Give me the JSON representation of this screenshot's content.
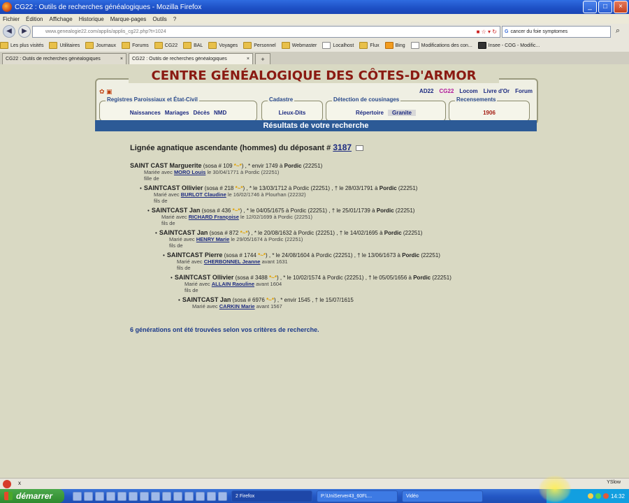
{
  "window": {
    "title": "CG22 : Outils de recherches généalogiques - Mozilla Firefox"
  },
  "menu": [
    "Fichier",
    "Édition",
    "Affichage",
    "Historique",
    "Marque-pages",
    "Outils",
    "?"
  ],
  "nav": {
    "url": "www.genealogie22.com/applis/applis_cg22.php?t=1024",
    "search_value": "cancer du foie symptomes"
  },
  "bookmarks": [
    "Les plus visités",
    "Utilitaires",
    "Journaux",
    "Forums",
    "CG22",
    "BAL",
    "Voyages",
    "Personnel",
    "Webmaster",
    "Localhost",
    "Flux",
    "Bing",
    "Modifications des con...",
    "Insee - COG - Modific..."
  ],
  "tabs": [
    {
      "label": "CG22 : Outils de recherches généalogiques"
    },
    {
      "label": "CG22 : Outils de recherches généalogiques"
    }
  ],
  "header": {
    "site_title": "CENTRE GÉNÉALOGIQUE DES CÔTES-D'ARMOR",
    "top_links": [
      "AD22",
      "CG22",
      "Locom",
      "Livre d'Or",
      "Forum"
    ],
    "groups": [
      {
        "legend": "Registres Paroissiaux et État-Civil",
        "links": [
          "Naissances",
          "Mariages",
          "Décès",
          "NMD"
        ]
      },
      {
        "legend": "Cadastre",
        "links": [
          "Lieux-Dits"
        ]
      },
      {
        "legend": "Détection de cousinages",
        "links": [
          "Répertoire",
          "Granite"
        ]
      },
      {
        "legend": "Recensements",
        "links": [
          "1906"
        ]
      }
    ]
  },
  "results": {
    "bar_title": "Résultats de votre recherche",
    "lineage_prefix": "Lignée agnatique ascendante (hommes) du déposant #",
    "depositor_number": "3187",
    "summary": "6 générations ont été trouvées selon vos critères de recherche."
  },
  "persons": [
    {
      "name": "SAINT CAST Marguerite",
      "sosa": "(sosa # 109",
      "dates": ") , * envir 1749 à ",
      "place": "Pordic",
      "code": " (22251)",
      "spouse_prefix": "Mariée avec ",
      "spouse": "MORO Louis",
      "spouse_suffix": " le 30/04/1771 à Pordic (22251)",
      "filiation": "fille de"
    },
    {
      "name": "SAINTCAST Ollivier",
      "sosa": "(sosa # 218",
      "dates": ") , * le 13/03/1712 à Pordic (22251) , † le 28/03/1791 à ",
      "place": "Pordic",
      "code": " (22251)",
      "spouse_prefix": "Marié avec ",
      "spouse": "BURLOT Claudine",
      "spouse_suffix": " le 16/02/1746 à Plourhan (22232)",
      "filiation": "fils de"
    },
    {
      "name": "SAINTCAST Jan",
      "sosa": "(sosa # 436",
      "dates": ") , * le 04/05/1675 à Pordic (22251) , † le 25/01/1739 à ",
      "place": "Pordic",
      "code": " (22251)",
      "spouse_prefix": "Marié avec ",
      "spouse": "RICHARD Françoise",
      "spouse_suffix": " le 12/02/1699 à Pordic (22251)",
      "filiation": "fils de"
    },
    {
      "name": "SAINTCAST Jan",
      "sosa": "(sosa # 872",
      "dates": ") , * le 20/08/1632 à Pordic (22251) , † le 14/02/1695 à ",
      "place": "Pordic",
      "code": " (22251)",
      "spouse_prefix": "Marié avec ",
      "spouse": "HENRY Marie",
      "spouse_suffix": " le 29/05/1674 à Pordic (22251)",
      "filiation": "fils de"
    },
    {
      "name": "SAINTCAST Pierre",
      "sosa": "(sosa # 1744",
      "dates": ") , * le 24/08/1604 à Pordic (22251) , † le 13/06/1673 à ",
      "place": "Pordic",
      "code": " (22251)",
      "spouse_prefix": "Marié avec ",
      "spouse": "CHERBONNEL Jeanne",
      "spouse_suffix": " avant 1631",
      "filiation": "fils de"
    },
    {
      "name": "SAINTCAST Ollivier",
      "sosa": "(sosa # 3488",
      "dates": ") , * le 10/02/1574 à Pordic (22251) , † le 05/05/1656 à ",
      "place": "Pordic",
      "code": " (22251)",
      "spouse_prefix": "Marié avec ",
      "spouse": "ALLAIN Raouline",
      "spouse_suffix": " avant 1604",
      "filiation": "fils de"
    },
    {
      "name": "SAINTCAST Jan",
      "sosa": "(sosa # 6976",
      "dates": ") , * envir 1545 , † le 15/07/1615",
      "place": "",
      "code": "",
      "spouse_prefix": "Marié avec ",
      "spouse": "CARKIN Marie",
      "spouse_suffix": " avant 1567",
      "filiation": ""
    }
  ],
  "statusbar": {
    "close_label": "x",
    "right_text": "YSlow"
  },
  "taskbar": {
    "start_label": "démarrer",
    "buttons": [
      "2 Firefox",
      "P:\\UniServer43_60FL...",
      "Vidéo"
    ],
    "clock": "14:32"
  },
  "colors": {
    "site_title": "#8a1a12",
    "result_bar": "#2c5a96",
    "link": "#1c2a80"
  }
}
